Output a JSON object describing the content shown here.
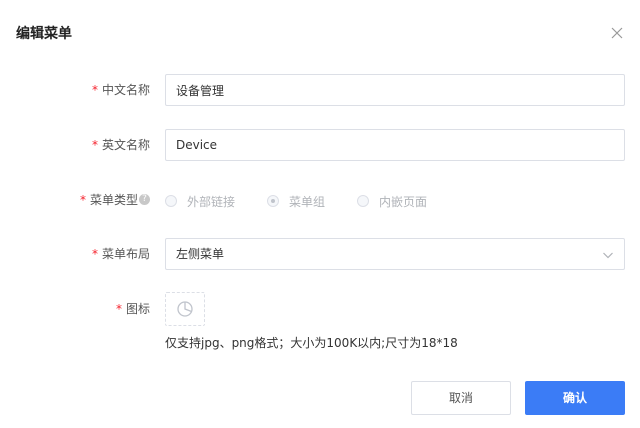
{
  "dialog": {
    "title": "编辑菜单",
    "close_icon": "close-icon"
  },
  "form": {
    "required_mark": "*",
    "chinese_name": {
      "label": "中文名称",
      "value": "设备管理"
    },
    "english_name": {
      "label": "英文名称",
      "value": "Device"
    },
    "menu_type": {
      "label": "菜单类型",
      "help_icon": "question-circle-icon",
      "help_glyph": "?",
      "disabled": true,
      "selected": "菜单组",
      "options": [
        {
          "label": "外部链接",
          "checked": false
        },
        {
          "label": "菜单组",
          "checked": true
        },
        {
          "label": "内嵌页面",
          "checked": false
        }
      ]
    },
    "menu_layout": {
      "label": "菜单布局",
      "value": "左侧菜单",
      "icon": "chevron-down-icon"
    },
    "icon_field": {
      "label": "图标",
      "upload_icon": "pie-chart-icon",
      "hint": "仅支持jpg、png格式；大小为100K以内;尺寸为18*18"
    }
  },
  "footer": {
    "cancel_label": "取消",
    "confirm_label": "确认"
  },
  "colors": {
    "primary": "#3b7cf6",
    "required": "#f5222d",
    "border": "#dcdfe6",
    "disabled_text": "#b0b3b8"
  }
}
